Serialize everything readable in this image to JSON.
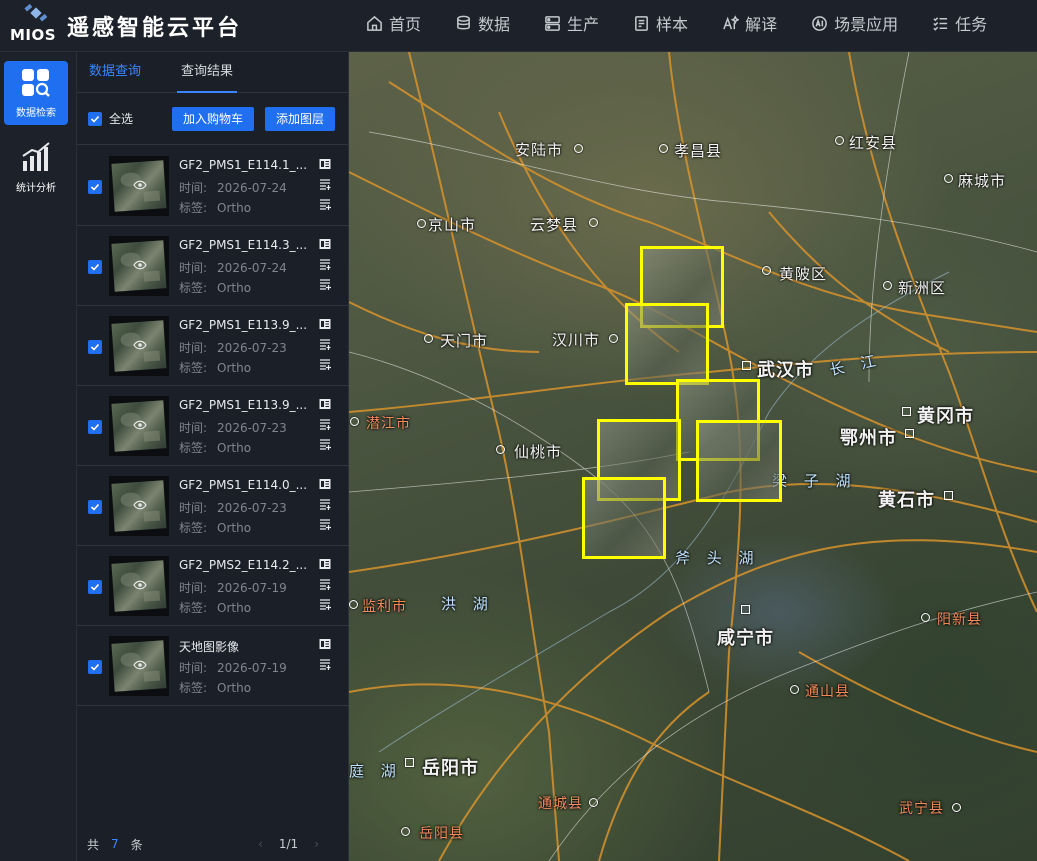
{
  "app": {
    "logo_text": "MIOS",
    "title": "遥感智能云平台"
  },
  "nav": [
    {
      "label": "首页",
      "icon": "home-icon"
    },
    {
      "label": "数据",
      "icon": "database-icon"
    },
    {
      "label": "生产",
      "icon": "production-icon"
    },
    {
      "label": "样本",
      "icon": "sample-icon"
    },
    {
      "label": "解译",
      "icon": "ai-interpret-icon"
    },
    {
      "label": "场景应用",
      "icon": "ai-scene-icon"
    },
    {
      "label": "任务",
      "icon": "task-list-icon"
    }
  ],
  "rail": [
    {
      "label": "数据检索",
      "icon": "data-search-icon",
      "active": true
    },
    {
      "label": "统计分析",
      "icon": "bar-chart-icon",
      "active": false
    }
  ],
  "panel": {
    "tabs": [
      {
        "label": "数据查询",
        "active": false
      },
      {
        "label": "查询结果",
        "active": true
      }
    ],
    "select_all_label": "全选",
    "add_cart_label": "加入购物车",
    "add_layer_label": "添加图层",
    "time_key": "时间:",
    "tag_key": "标签:",
    "items": [
      {
        "title": "GF2_PMS1_E114.1_...",
        "time": "2026-07-24",
        "tag": "Ortho"
      },
      {
        "title": "GF2_PMS1_E114.3_...",
        "time": "2026-07-24",
        "tag": "Ortho"
      },
      {
        "title": "GF2_PMS1_E113.9_...",
        "time": "2026-07-23",
        "tag": "Ortho"
      },
      {
        "title": "GF2_PMS1_E113.9_...",
        "time": "2026-07-23",
        "tag": "Ortho"
      },
      {
        "title": "GF2_PMS1_E114.0_...",
        "time": "2026-07-23",
        "tag": "Ortho"
      },
      {
        "title": "GF2_PMS2_E114.2_...",
        "time": "2026-07-19",
        "tag": "Ortho"
      },
      {
        "title": "天地图影像",
        "time": "2026-07-19",
        "tag": "Ortho"
      }
    ],
    "footer": {
      "prefix": "共",
      "count": "7",
      "suffix": "条",
      "page": "1/1"
    }
  },
  "map": {
    "labels": [
      {
        "text": "京山市"
      },
      {
        "text": "安陆市"
      },
      {
        "text": "孝昌县"
      },
      {
        "text": "红安县"
      },
      {
        "text": "麻城市"
      },
      {
        "text": "云梦县"
      },
      {
        "text": "黄陂区"
      },
      {
        "text": "新洲区"
      },
      {
        "text": "天门市"
      },
      {
        "text": "汉川市"
      },
      {
        "text": "武汉市"
      },
      {
        "text": "潜江市"
      },
      {
        "text": "黄冈市"
      },
      {
        "text": "仙桃市"
      },
      {
        "text": "鄂州市"
      },
      {
        "text": "黄石市"
      },
      {
        "text": "监利市"
      },
      {
        "text": "咸宁市"
      },
      {
        "text": "阳新县"
      },
      {
        "text": "通山县"
      },
      {
        "text": "岳阳市"
      },
      {
        "text": "通城县"
      },
      {
        "text": "武宁县"
      },
      {
        "text": "岳阳县"
      },
      {
        "text": "长 江"
      },
      {
        "text": "梁 子 湖"
      },
      {
        "text": "斧 头 湖"
      },
      {
        "text": "洪 湖"
      },
      {
        "text": "庭 湖"
      }
    ],
    "footprint_color": "#ffff00"
  },
  "colors": {
    "accent": "#1f6ff0",
    "tab_inactive": "#3a86ff",
    "footprint": "#ffff00"
  }
}
